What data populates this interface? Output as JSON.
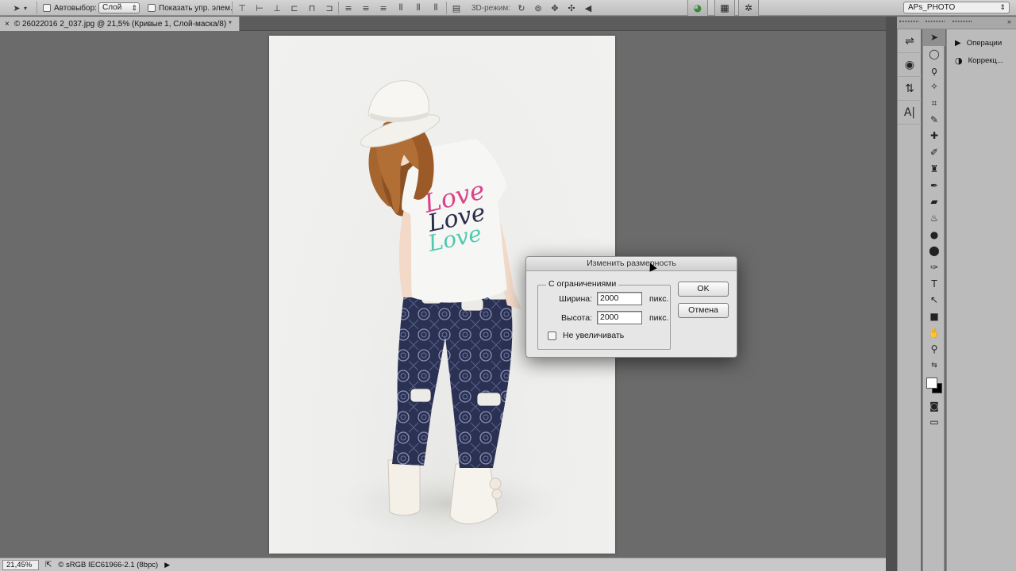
{
  "options_bar": {
    "move_tool_icon": "move-tool-icon",
    "auto_select_label": "Автовыбор:",
    "auto_select_value": "Слой",
    "show_transform_label": "Показать упр. элем.",
    "mode_3d_label": "3D-режим:",
    "workspace": "APs_PHOTO"
  },
  "document": {
    "tab_title": "© 26022016 2_037.jpg @ 21,5% (Кривые 1, Слой-маска/8) *",
    "close_glyph": "×"
  },
  "status": {
    "zoom": "21,45%",
    "profile": "© sRGB IEC61966-2.1 (8bpc)"
  },
  "panels": {
    "items": [
      {
        "label": "Операции",
        "icon": "play-icon"
      },
      {
        "label": "Коррекц...",
        "icon": "adjustments-icon"
      }
    ]
  },
  "dialog": {
    "title": "Изменить размерность",
    "group_label": "С ограничениями",
    "width_label": "Ширина:",
    "width_value": "2000",
    "width_unit": "пикс.",
    "height_label": "Высота:",
    "height_value": "2000",
    "height_unit": "пикс.",
    "no_enlarge_label": "Не увеличивать",
    "no_enlarge_checked": false,
    "ok_label": "OK",
    "cancel_label": "Отмена"
  },
  "photo": {
    "shirt_text": "Love"
  },
  "colors": {
    "canvas_bg": "#6b6b6b",
    "ui_panel": "#bbbbbb",
    "shirt_pink": "#d9448a",
    "shirt_navy": "#2a2d4a",
    "shirt_teal": "#4fc9b0",
    "pants_navy": "#2b3152"
  }
}
